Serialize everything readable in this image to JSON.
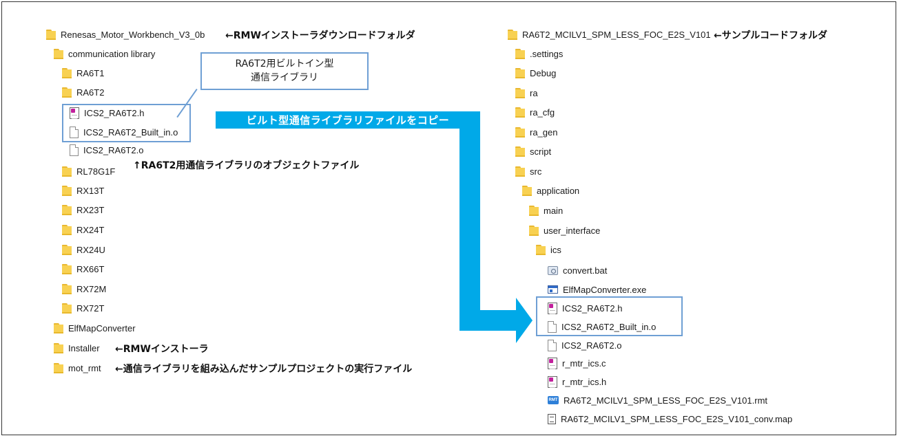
{
  "left_tree": {
    "root": "Renesas_Motor_Workbench_V3_0b",
    "communication_library": "communication library",
    "ra6t1": "RA6T1",
    "ra6t2": "RA6T2",
    "files_highlighted": [
      "ICS2_RA6T2.h",
      "ICS2_RA6T2_Built_in.o"
    ],
    "file_obj": "ICS2_RA6T2.o",
    "chips": [
      "RL78G1F",
      "RX13T",
      "RX23T",
      "RX24T",
      "RX24U",
      "RX66T",
      "RX72M",
      "RX72T"
    ],
    "elfmap": "ElfMapConverter",
    "installer": "Installer",
    "mot_rmt": "mot_rmt"
  },
  "right_tree": {
    "root": "RA6T2_MCILV1_SPM_LESS_FOC_E2S_V101",
    "folders": [
      ".settings",
      "Debug",
      "ra",
      "ra_cfg",
      "ra_gen",
      "script",
      "src"
    ],
    "application": "application",
    "main": "main",
    "user_interface": "user_interface",
    "ics": "ics",
    "convert_bat": "convert.bat",
    "elfmap_exe": "ElfMapConverter.exe",
    "files_highlighted": [
      "ICS2_RA6T2.h",
      "ICS2_RA6T2_Built_in.o"
    ],
    "file_obj": "ICS2_RA6T2.o",
    "mtr_c": "r_mtr_ics.c",
    "mtr_h": "r_mtr_ics.h",
    "rmt_file": "RA6T2_MCILV1_SPM_LESS_FOC_E2S_V101.rmt",
    "map_file": "RA6T2_MCILV1_SPM_LESS_FOC_E2S_V101_conv.map",
    "rmt_icon_text": "RMT"
  },
  "annotations": {
    "rmw_download": "←RMWインストーラダウンロードフォルダ",
    "sample_code": "←サンプルコードフォルダ",
    "callout_line1": "RA6T2用ビルトイン型",
    "callout_line2": "通信ライブラリ",
    "copy_banner": "ビルト型通信ライブラリファイルをコピー",
    "object_file": "↑RA6T2用通信ライブラリのオブジェクトファイル",
    "installer": "←RMWインストーラ",
    "mot_rmt": "←通信ライブラリを組み込んだサンプルプロジェクトの実行ファイル"
  },
  "colors": {
    "accent_blue": "#00a9e8",
    "highlight_border": "#6e9fd4",
    "folder_yellow": "#f8d152"
  }
}
